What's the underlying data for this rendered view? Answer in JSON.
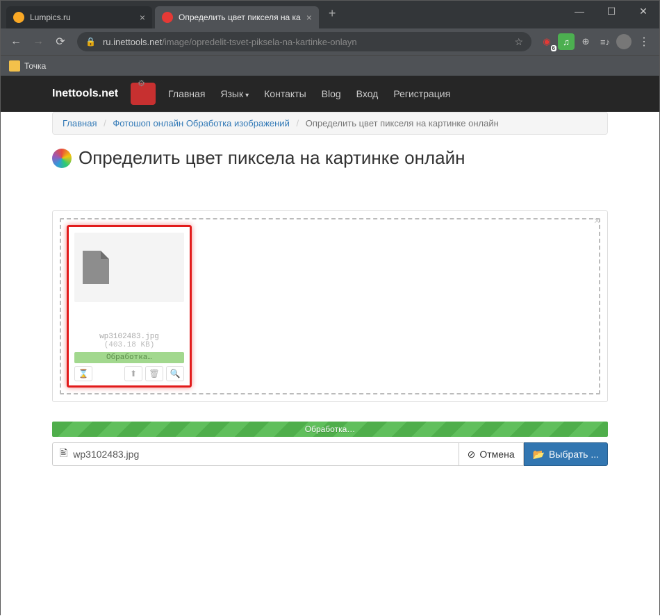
{
  "window": {
    "tabs": [
      {
        "title": "Lumpics.ru",
        "favicon_color": "#f9a825"
      },
      {
        "title": "Определить цвет пикселя на ка",
        "favicon_color": "#e53935"
      }
    ],
    "active_tab": 1,
    "url_host": "ru.inettools.net",
    "url_path": "/image/opredelit-tsvet-piksela-na-kartinke-onlayn",
    "bookmarks": [
      {
        "label": "Точка"
      }
    ],
    "ext_badge": "6"
  },
  "site": {
    "brand": "Inettools.net",
    "nav": {
      "home": "Главная",
      "lang": "Язык",
      "contacts": "Контакты",
      "blog": "Blog",
      "login": "Вход",
      "register": "Регистрация"
    }
  },
  "breadcrumb": {
    "home": "Главная",
    "cat": "Фотошоп онлайн Обработка изображений",
    "current": "Определить цвет пикселя на картинке онлайн"
  },
  "page": {
    "title": "Определить цвет пиксела на картинке онлайн"
  },
  "upload": {
    "file_name": "wp3102483.jpg",
    "file_size": "(403.18 KB)",
    "card_status": "Обработка…",
    "big_status": "Обработка…",
    "input_value": "wp3102483.jpg",
    "cancel_label": "Отмена",
    "select_label": "Выбрать ..."
  }
}
